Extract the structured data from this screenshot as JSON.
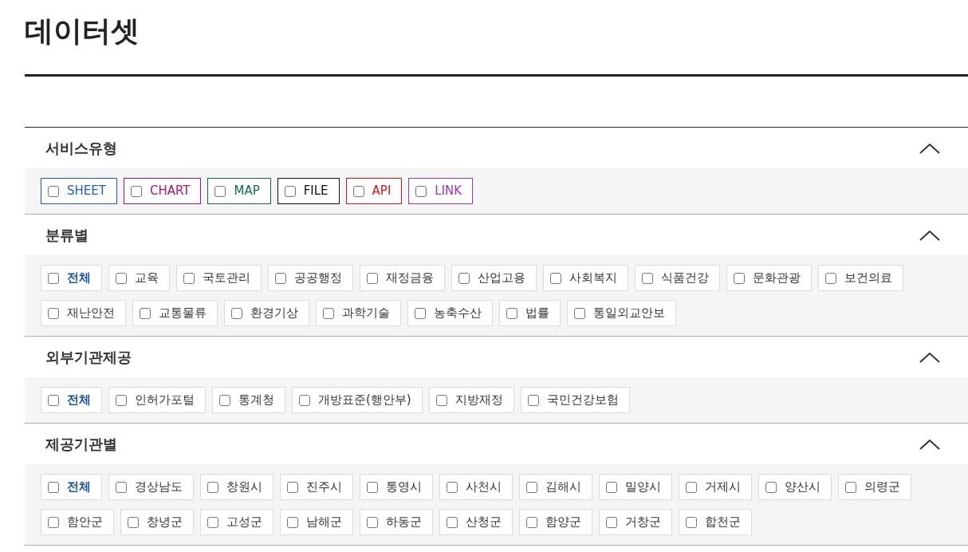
{
  "title": "데이터셋",
  "sections": [
    {
      "title": "서비스유형",
      "expanded": true,
      "options": [
        {
          "label": "SHEET",
          "checked": false,
          "kind": "type",
          "color": "#1c5cc4"
        },
        {
          "label": "CHART",
          "checked": false,
          "kind": "type",
          "color": "#b0106e"
        },
        {
          "label": "MAP",
          "checked": false,
          "kind": "type",
          "color": "#0d6b4a"
        },
        {
          "label": "FILE",
          "checked": false,
          "kind": "type",
          "color": "#111111"
        },
        {
          "label": "API",
          "checked": false,
          "kind": "type",
          "color": "#e0101e"
        },
        {
          "label": "LINK",
          "checked": false,
          "kind": "type",
          "color": "#a030c8"
        }
      ]
    },
    {
      "title": "분류별",
      "expanded": true,
      "options": [
        {
          "label": "전체",
          "checked": false,
          "kind": "all"
        },
        {
          "label": "교육",
          "checked": false,
          "kind": "plain"
        },
        {
          "label": "국토관리",
          "checked": false,
          "kind": "plain"
        },
        {
          "label": "공공행정",
          "checked": false,
          "kind": "plain"
        },
        {
          "label": "재정금융",
          "checked": false,
          "kind": "plain"
        },
        {
          "label": "산업고용",
          "checked": false,
          "kind": "plain"
        },
        {
          "label": "사회복지",
          "checked": false,
          "kind": "plain"
        },
        {
          "label": "식품건강",
          "checked": false,
          "kind": "plain"
        },
        {
          "label": "문화관광",
          "checked": false,
          "kind": "plain"
        },
        {
          "label": "보건의료",
          "checked": false,
          "kind": "plain"
        },
        {
          "label": "재난안전",
          "checked": false,
          "kind": "plain"
        },
        {
          "label": "교통물류",
          "checked": false,
          "kind": "plain"
        },
        {
          "label": "환경기상",
          "checked": false,
          "kind": "plain"
        },
        {
          "label": "과학기술",
          "checked": false,
          "kind": "plain"
        },
        {
          "label": "농축수산",
          "checked": false,
          "kind": "plain"
        },
        {
          "label": "법률",
          "checked": false,
          "kind": "plain"
        },
        {
          "label": "통일외교안보",
          "checked": false,
          "kind": "plain"
        }
      ]
    },
    {
      "title": "외부기관제공",
      "expanded": true,
      "options": [
        {
          "label": "전체",
          "checked": false,
          "kind": "all"
        },
        {
          "label": "인허가포털",
          "checked": false,
          "kind": "plain"
        },
        {
          "label": "통계청",
          "checked": false,
          "kind": "plain"
        },
        {
          "label": "개방표준(행안부)",
          "checked": false,
          "kind": "plain"
        },
        {
          "label": "지방재정",
          "checked": false,
          "kind": "plain"
        },
        {
          "label": "국민건강보험",
          "checked": false,
          "kind": "plain"
        }
      ]
    },
    {
      "title": "제공기관별",
      "expanded": true,
      "options": [
        {
          "label": "전체",
          "checked": false,
          "kind": "all"
        },
        {
          "label": "경상남도",
          "checked": false,
          "kind": "plain"
        },
        {
          "label": "창원시",
          "checked": false,
          "kind": "plain"
        },
        {
          "label": "진주시",
          "checked": false,
          "kind": "plain"
        },
        {
          "label": "통영시",
          "checked": false,
          "kind": "plain"
        },
        {
          "label": "사천시",
          "checked": false,
          "kind": "plain"
        },
        {
          "label": "김해시",
          "checked": false,
          "kind": "plain"
        },
        {
          "label": "밀양시",
          "checked": false,
          "kind": "plain"
        },
        {
          "label": "거제시",
          "checked": false,
          "kind": "plain"
        },
        {
          "label": "양산시",
          "checked": false,
          "kind": "plain"
        },
        {
          "label": "의령군",
          "checked": false,
          "kind": "plain"
        },
        {
          "label": "함안군",
          "checked": false,
          "kind": "plain"
        },
        {
          "label": "창녕군",
          "checked": false,
          "kind": "plain"
        },
        {
          "label": "고성군",
          "checked": false,
          "kind": "plain"
        },
        {
          "label": "남해군",
          "checked": false,
          "kind": "plain"
        },
        {
          "label": "하동군",
          "checked": false,
          "kind": "plain"
        },
        {
          "label": "산청군",
          "checked": false,
          "kind": "plain"
        },
        {
          "label": "함양군",
          "checked": false,
          "kind": "plain"
        },
        {
          "label": "거창군",
          "checked": false,
          "kind": "plain"
        },
        {
          "label": "합천군",
          "checked": false,
          "kind": "plain"
        }
      ]
    }
  ]
}
